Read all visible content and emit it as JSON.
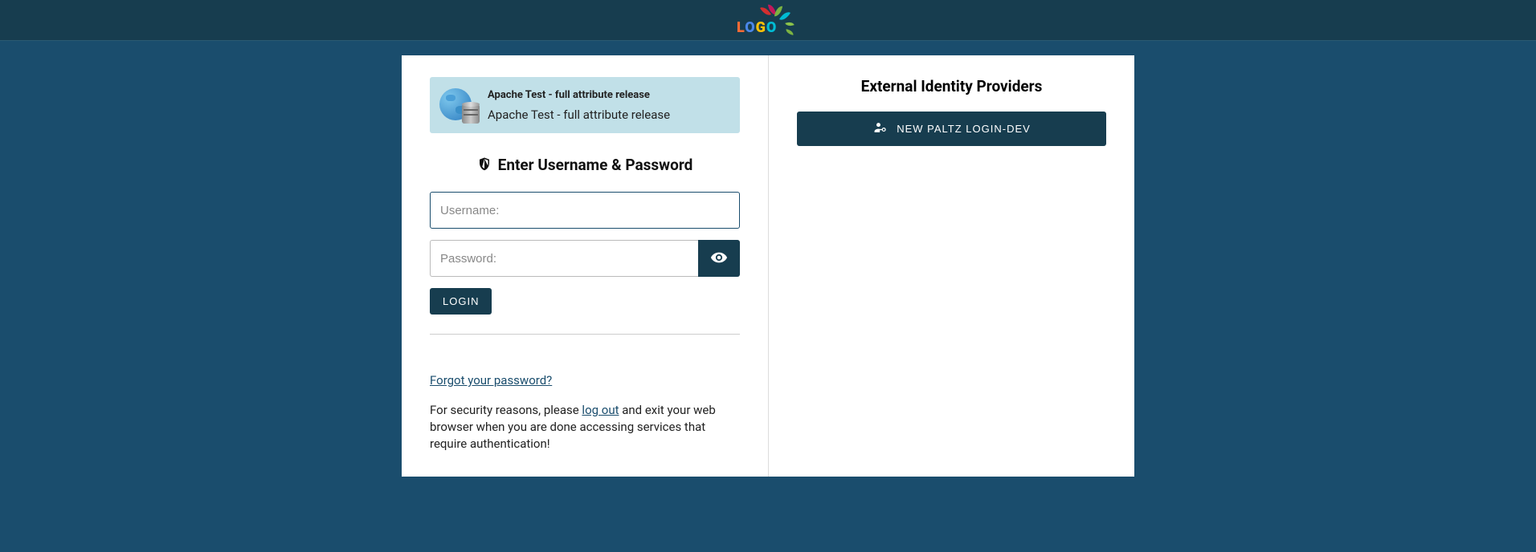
{
  "header": {
    "logo_text": [
      "L",
      "O",
      "G",
      "O"
    ]
  },
  "service": {
    "title": "Apache Test - full attribute release",
    "description": "Apache Test - full attribute release"
  },
  "form": {
    "heading": "Enter Username & Password",
    "username_placeholder": "Username:",
    "password_placeholder": "Password:",
    "login_label": "LOGIN"
  },
  "links": {
    "forgot_password": "Forgot your password?",
    "logout": "log out"
  },
  "security_text": {
    "prefix": "For security reasons, please ",
    "suffix": " and exit your web browser when you are done accessing services that require authentication!"
  },
  "idp": {
    "heading": "External Identity Providers",
    "button_label": "NEW PALTZ LOGIN-DEV"
  }
}
